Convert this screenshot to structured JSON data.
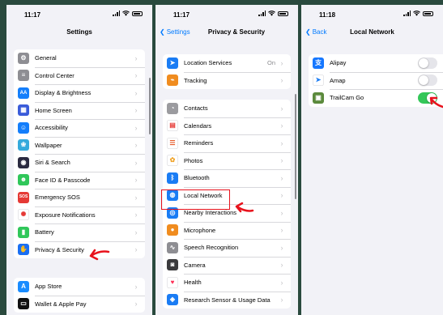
{
  "colors": {
    "background": "#2a4a3e",
    "accent": "#007aff",
    "toggle_on": "#34c759",
    "annotation": "#e8121c"
  },
  "screen1": {
    "time": "11:17",
    "title": "Settings",
    "groups": [
      [
        {
          "label": "General",
          "icon": "gear-icon",
          "color": "#8e8e93"
        },
        {
          "label": "Control Center",
          "icon": "sliders-icon",
          "color": "#8e8e93"
        },
        {
          "label": "Display & Brightness",
          "icon": "aa-text-icon",
          "color": "#147efb"
        },
        {
          "label": "Home Screen",
          "icon": "grid-icon",
          "color": "#3a5bd9"
        },
        {
          "label": "Accessibility",
          "icon": "accessibility-icon",
          "color": "#147efb"
        },
        {
          "label": "Wallpaper",
          "icon": "flower-icon",
          "color": "#35aadc"
        },
        {
          "label": "Siri & Search",
          "icon": "siri-icon",
          "color": "#2a2a40"
        },
        {
          "label": "Face ID & Passcode",
          "icon": "face-id-icon",
          "color": "#30c75a"
        },
        {
          "label": "Emergency SOS",
          "icon": "sos-icon",
          "color": "#e53935"
        },
        {
          "label": "Exposure Notifications",
          "icon": "exposure-icon",
          "color": "#ffffff"
        },
        {
          "label": "Battery",
          "icon": "battery-icon",
          "color": "#30c75a"
        },
        {
          "label": "Privacy & Security",
          "icon": "hand-icon",
          "color": "#1a6ff3"
        }
      ],
      [
        {
          "label": "App Store",
          "icon": "app-store-icon",
          "color": "#1a8cff"
        },
        {
          "label": "Wallet & Apple Pay",
          "icon": "wallet-icon",
          "color": "#111111"
        }
      ]
    ]
  },
  "screen2": {
    "time": "11:17",
    "back": "Settings",
    "title": "Privacy & Security",
    "groups": [
      [
        {
          "label": "Location Services",
          "icon": "location-arrow-icon",
          "color": "#1a7cf4",
          "value": "On"
        },
        {
          "label": "Tracking",
          "icon": "tracking-icon",
          "color": "#f08c1f"
        }
      ],
      [
        {
          "label": "Contacts",
          "icon": "contacts-icon",
          "color": "#9b9b9f"
        },
        {
          "label": "Calendars",
          "icon": "calendar-icon",
          "color": "#ffffff"
        },
        {
          "label": "Reminders",
          "icon": "reminders-icon",
          "color": "#ffffff"
        },
        {
          "label": "Photos",
          "icon": "photos-icon",
          "color": "#ffffff"
        },
        {
          "label": "Bluetooth",
          "icon": "bluetooth-icon",
          "color": "#1a7cf4"
        },
        {
          "label": "Local Network",
          "icon": "globe-icon",
          "color": "#1a7cf4"
        },
        {
          "label": "Nearby Interactions",
          "icon": "nearby-icon",
          "color": "#1a7cf4"
        },
        {
          "label": "Microphone",
          "icon": "microphone-icon",
          "color": "#f08c1f"
        },
        {
          "label": "Speech Recognition",
          "icon": "waveform-icon",
          "color": "#8e8e93"
        },
        {
          "label": "Camera",
          "icon": "camera-icon",
          "color": "#3a3a3c"
        },
        {
          "label": "Health",
          "icon": "heart-icon",
          "color": "#ffffff"
        },
        {
          "label": "Research Sensor & Usage Data",
          "icon": "research-icon",
          "color": "#1a7cf4"
        }
      ]
    ]
  },
  "screen3": {
    "time": "11:18",
    "back": "Back",
    "title": "Local Network",
    "apps": [
      {
        "label": "Alipay",
        "icon": "alipay-icon",
        "color": "#1677ff",
        "enabled": false
      },
      {
        "label": "Amap",
        "icon": "amap-icon",
        "color": "#ffffff",
        "enabled": false
      },
      {
        "label": "TrailCam Go",
        "icon": "trailcam-icon",
        "color": "#5b8a3c",
        "enabled": true
      }
    ]
  }
}
